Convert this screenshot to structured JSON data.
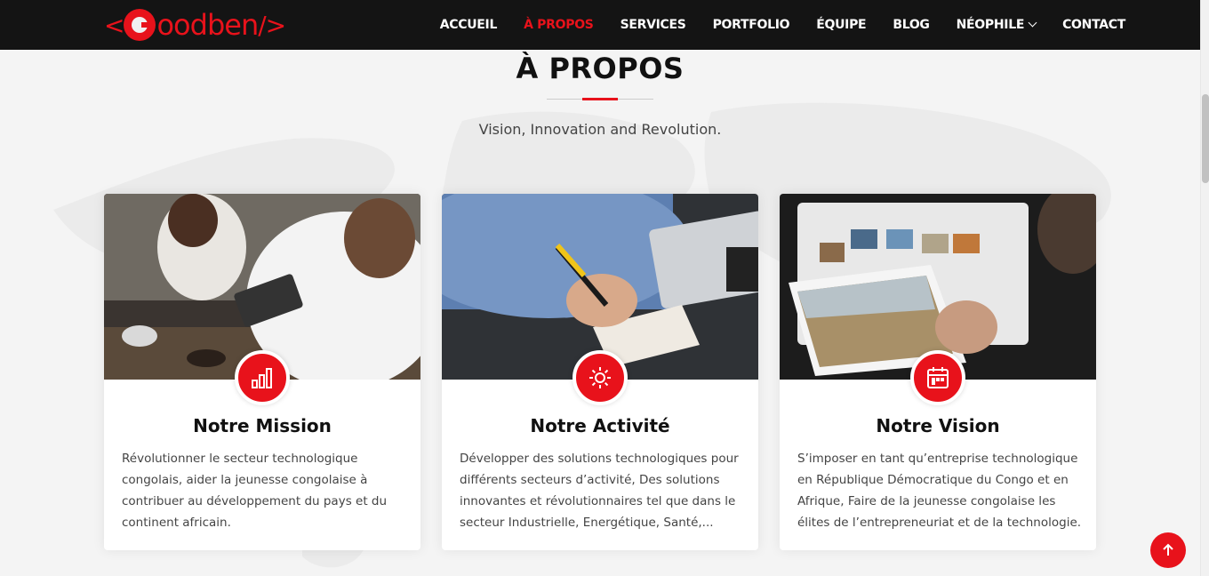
{
  "logo": {
    "text_left": "<",
    "word": "oodben",
    "text_right": "/>"
  },
  "nav": {
    "items": [
      {
        "label": "ACCUEIL",
        "active": false
      },
      {
        "label": "À PROPOS",
        "active": true
      },
      {
        "label": "SERVICES",
        "active": false
      },
      {
        "label": "PORTFOLIO",
        "active": false
      },
      {
        "label": "ÉQUIPE",
        "active": false
      },
      {
        "label": "BLOG",
        "active": false
      },
      {
        "label": "NÉOPHILE",
        "active": false,
        "dropdown": true
      },
      {
        "label": "CONTACT",
        "active": false
      }
    ]
  },
  "section": {
    "title": "À PROPOS",
    "subtitle": "Vision, Innovation and Revolution."
  },
  "cards": [
    {
      "icon": "bar-chart-icon",
      "title": "Notre Mission",
      "text": "Révolutionner le secteur technologique congolais, aider la jeunesse congolaise à contribuer au développement du pays et du continent africain."
    },
    {
      "icon": "sun-icon",
      "title": "Notre Activité",
      "text": "Développer des solutions technologiques pour différents secteurs d’activité, Des solutions innovantes et révolutionnaires tel que dans le secteur Industrielle, Energétique, Santé,..."
    },
    {
      "icon": "calendar-icon",
      "title": "Notre Vision",
      "text": "S’imposer en tant qu’entreprise technologique en République Démocratique du Congo et en Afrique, Faire de la jeunesse congolaise les élites de l’entrepreneuriat et de la technologie."
    }
  ],
  "colors": {
    "accent": "#e8121b",
    "navbar": "#141414",
    "background": "#f4f4f4"
  },
  "back_to_top": {
    "icon": "arrow-up-icon"
  }
}
